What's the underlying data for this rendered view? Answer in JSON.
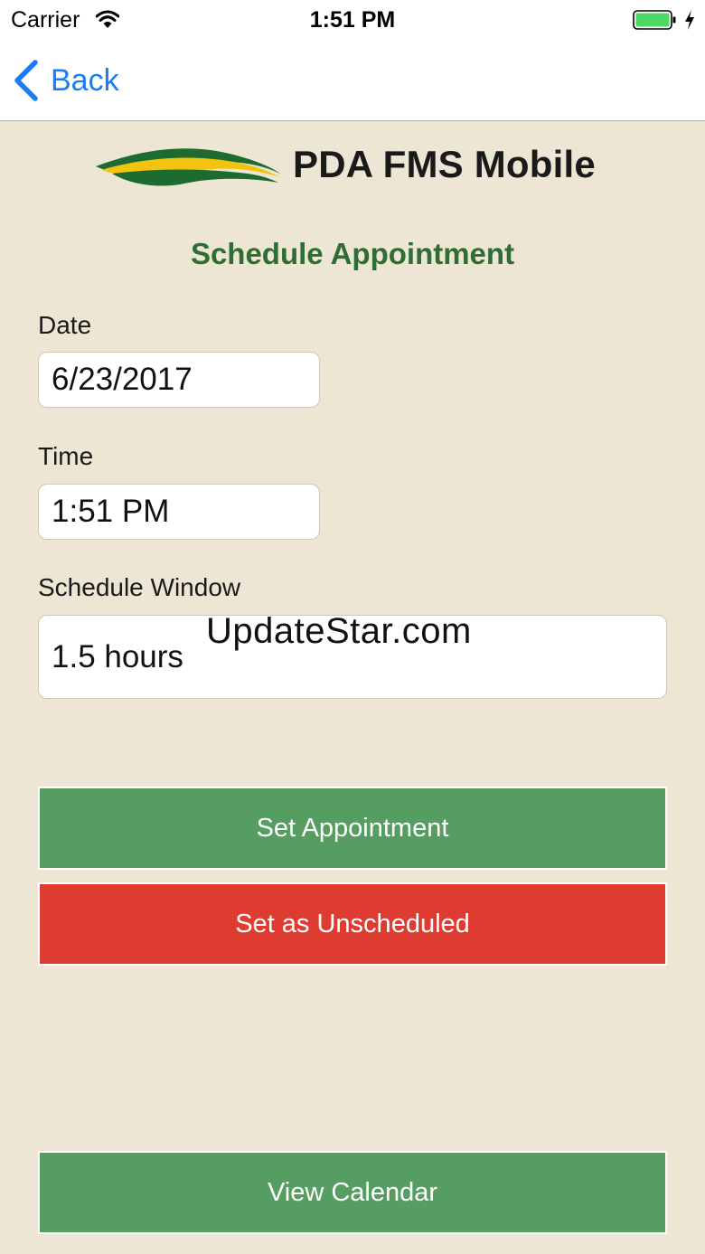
{
  "status_bar": {
    "carrier": "Carrier",
    "time": "1:51 PM",
    "battery_color": "#4cd964"
  },
  "nav": {
    "back_label": "Back",
    "accent": "#1b7cf6"
  },
  "header": {
    "app_title": "PDA FMS Mobile"
  },
  "form": {
    "section_title": "Schedule Appointment",
    "date_label": "Date",
    "date_value": "6/23/2017",
    "time_label": "Time",
    "time_value": "1:51 PM",
    "window_label": "Schedule Window",
    "window_value": "1.5 hours"
  },
  "actions": {
    "set_appointment": "Set Appointment",
    "set_unscheduled": "Set as Unscheduled",
    "view_calendar": "View Calendar"
  },
  "watermark": "UpdateStar.com",
  "colors": {
    "background": "#ede6d4",
    "primary_green": "#569d62",
    "danger_red": "#de3c31",
    "title_green": "#2f6e32"
  }
}
